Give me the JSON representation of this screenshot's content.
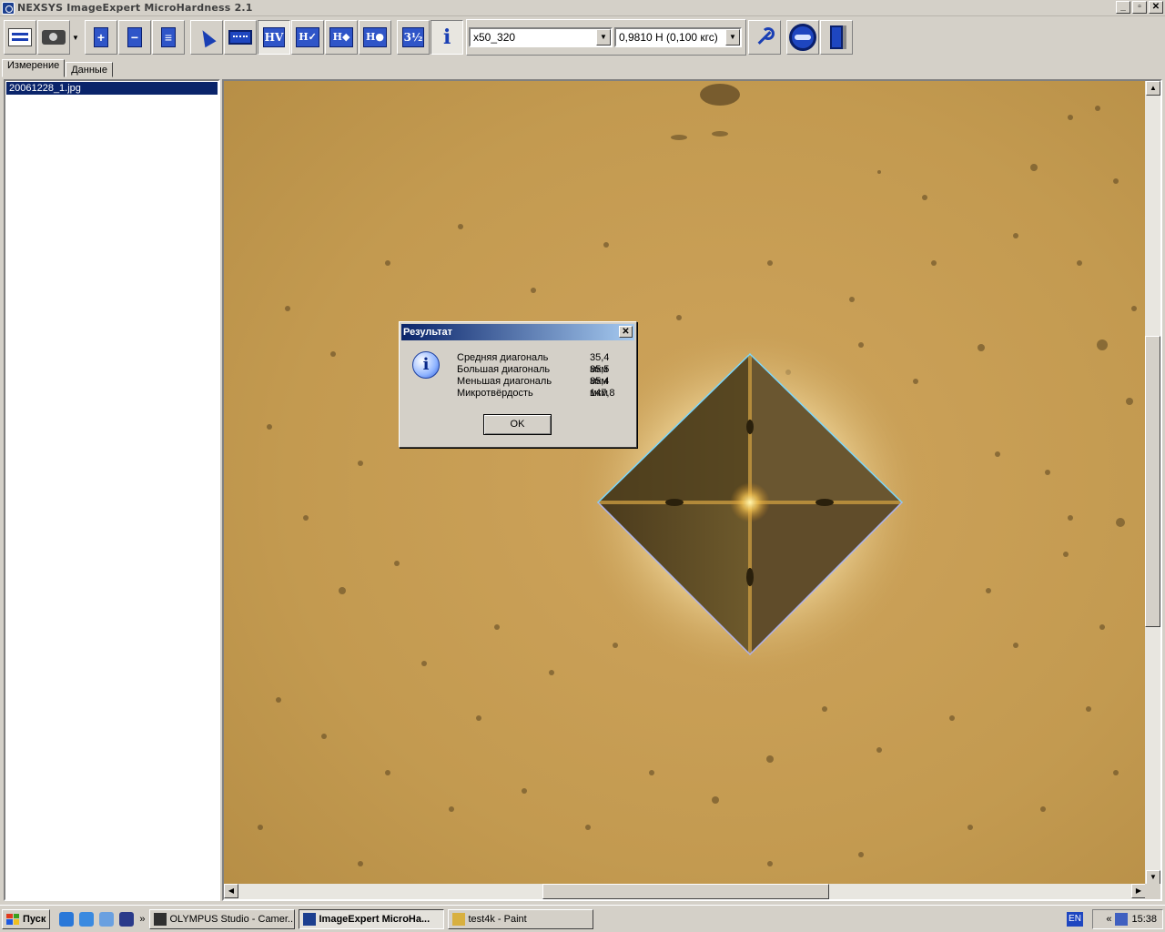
{
  "window": {
    "title": "NEXSYS ImageExpert MicroHardness 2.1",
    "buttons": {
      "minimize": "_",
      "maximize": "▫",
      "close": "✕"
    }
  },
  "toolbar": {
    "objective_select": "x50_320",
    "load_select": "0,9810 Н   (0,100 кгс)"
  },
  "tabs": [
    {
      "label": "Измерение",
      "active": true
    },
    {
      "label": "Данные",
      "active": false
    }
  ],
  "files": [
    {
      "name": "20061228_1.jpg",
      "selected": true
    }
  ],
  "dialog": {
    "title": "Результат",
    "rows": [
      {
        "label": "Средняя диагональ",
        "value": "35,4 мкм"
      },
      {
        "label": "Большая диагональ",
        "value": "35,5 мкм"
      },
      {
        "label": "Меньшая диагональ",
        "value": "35,4 мкм"
      },
      {
        "label": "Микротвёрдость",
        "value": "147,8"
      }
    ],
    "ok_label": "OK",
    "close_glyph": "✕"
  },
  "taskbar": {
    "start_label": "Пуск",
    "overflow_glyph": "»",
    "tasks": [
      {
        "label": "OLYMPUS Studio - Camer...",
        "active": false
      },
      {
        "label": "ImageExpert MicroHa...",
        "active": true
      },
      {
        "label": "test4k - Paint",
        "active": false
      }
    ],
    "language": "EN",
    "tray_collapse": "«",
    "clock": "15:38"
  }
}
